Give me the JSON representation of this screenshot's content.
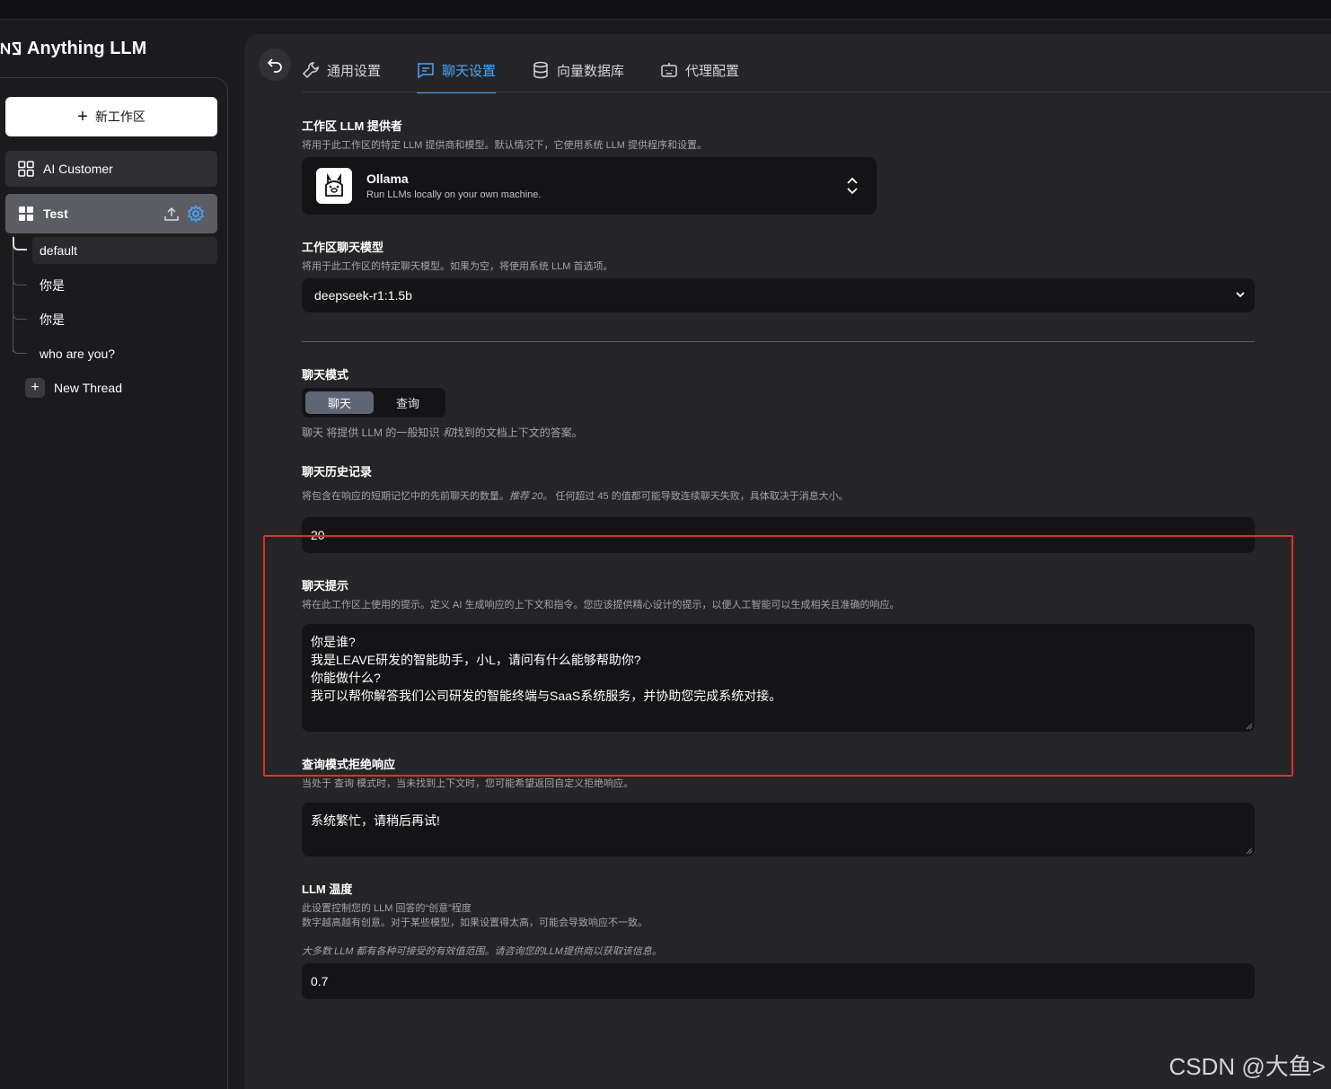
{
  "app": {
    "name": "Anything LLM"
  },
  "sidebar": {
    "new_workspace_label": "新工作区",
    "workspaces": [
      {
        "label": "AI Customer"
      },
      {
        "label": "Test"
      }
    ],
    "threads": [
      {
        "label": "default"
      },
      {
        "label": "你是"
      },
      {
        "label": "你是"
      },
      {
        "label": "who are you?"
      }
    ],
    "new_thread_label": "New Thread"
  },
  "tabs": [
    {
      "label": "通用设置"
    },
    {
      "label": "聊天设置"
    },
    {
      "label": "向量数据库"
    },
    {
      "label": "代理配置"
    }
  ],
  "settings": {
    "provider": {
      "title": "工作区 LLM 提供者",
      "desc": "将用于此工作区的特定 LLM 提供商和模型。默认情况下，它使用系统 LLM 提供程序和设置。",
      "name": "Ollama",
      "tagline": "Run LLMs locally on your own machine."
    },
    "model": {
      "title": "工作区聊天模型",
      "desc": "将用于此工作区的特定聊天模型。如果为空，将使用系统 LLM 首选项。",
      "value": "deepseek-r1:1.5b"
    },
    "mode": {
      "title": "聊天模式",
      "option_chat": "聊天",
      "option_query": "查询",
      "desc_a": "聊天",
      "desc_b": " 将提供 LLM 的一般知识 ",
      "desc_c": "和",
      "desc_d": "找到的文档上下文的答案。"
    },
    "history": {
      "title": "聊天历史记录",
      "desc_a": "将包含在响应的短期记忆中的先前聊天的数量。",
      "desc_b": "推荐 20。",
      "desc_c": " 任何超过 45 的值都可能导致连续聊天失败，具体取决于消息大小。",
      "value": "20"
    },
    "prompt": {
      "title": "聊天提示",
      "desc": "将在此工作区上使用的提示。定义 AI 生成响应的上下文和指令。您应该提供精心设计的提示，以便人工智能可以生成相关且准确的响应。",
      "lines": [
        "你是谁?",
        "我是LEAVE研发的智能助手，小L，请问有什么能够帮助你?",
        "你能做什么?",
        "我可以帮你解答我们公司研发的智能终端与SaaS系统服务，并协助您完成系统对接。"
      ]
    },
    "refusal": {
      "title": "查询模式拒绝响应",
      "desc": "当处于 查询 模式时，当未找到上下文时，您可能希望返回自定义拒绝响应。",
      "value": "系统繁忙，请稍后再试!"
    },
    "temperature": {
      "title": "LLM 温度",
      "desc_1": "此设置控制您的 LLM 回答的“创意”程度",
      "desc_2": "数字越高越有创意。对于某些模型，如果设置得太高，可能会导致响应不一致。",
      "desc_3": "大多数 LLM 都有各种可接受的有效值范围。请咨询您的LLM提供商以获取该信息。",
      "value": "0.7"
    }
  },
  "watermark": "CSDN @大鱼>",
  "colors": {
    "accent": "#46a6ff",
    "highlight": "#e0302a"
  }
}
